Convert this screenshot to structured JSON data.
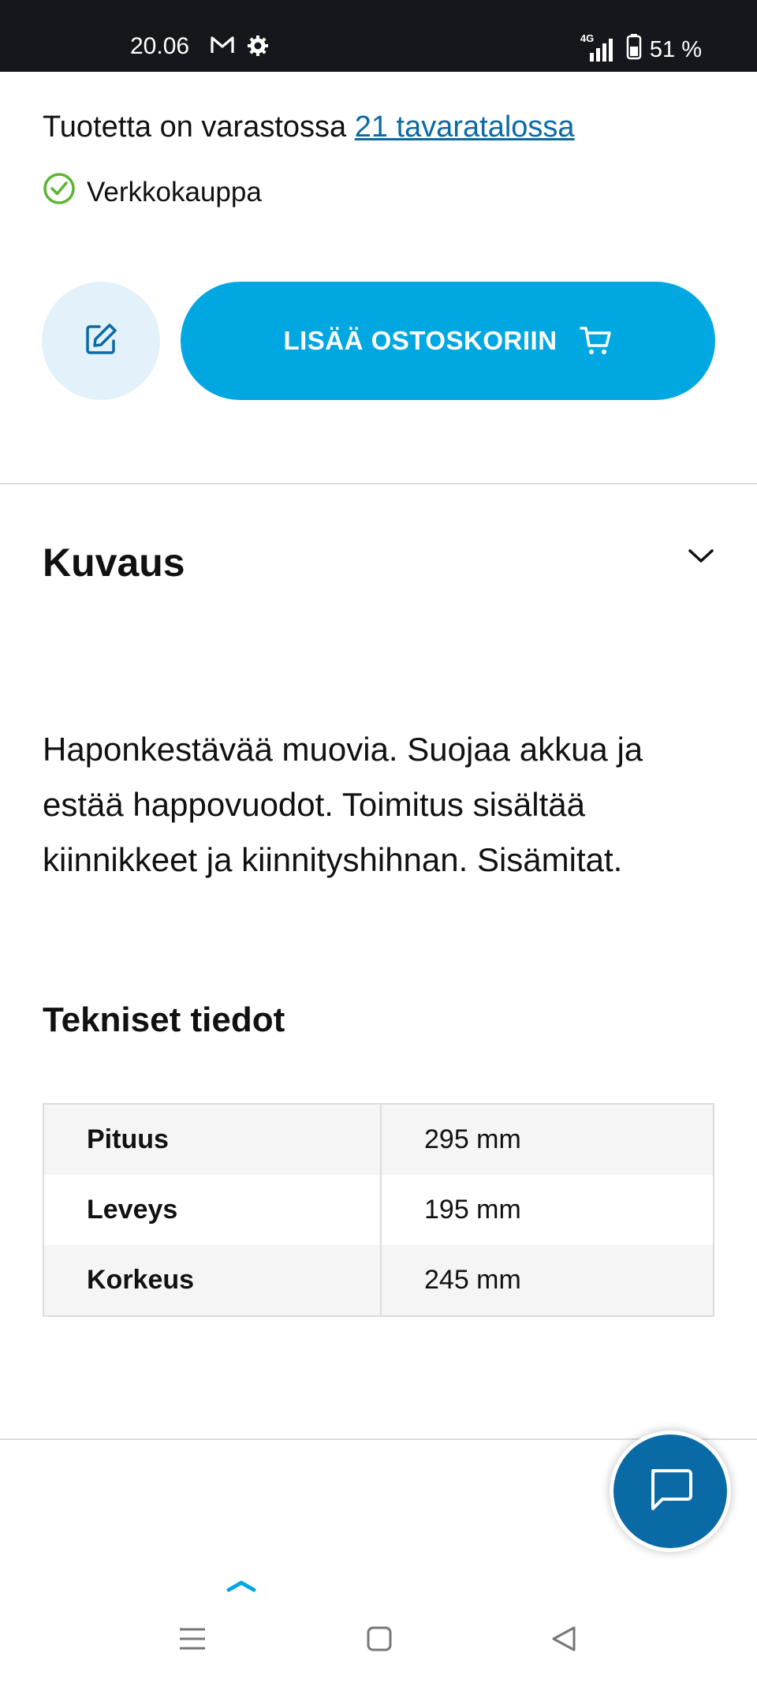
{
  "status_bar": {
    "time": "20.06",
    "network": "4G",
    "battery": "51 %"
  },
  "stock": {
    "prefix": "Tuotetta on varastossa",
    "link": "21 tavaratalossa"
  },
  "webshop": {
    "label": "Verkkokauppa"
  },
  "actions": {
    "add_to_cart": "LISÄÄ OSTOSKORIIN"
  },
  "description": {
    "heading": "Kuvaus",
    "text": "Haponkestävää muovia. Suojaa akkua ja estää happovuodot. Toimitus sisältää kiinnikkeet ja kiinnityshihnan. Sisämitat."
  },
  "specs": {
    "heading": "Tekniset tiedot",
    "rows": [
      {
        "label": "Pituus",
        "value": "295 mm"
      },
      {
        "label": "Leveys",
        "value": "195 mm"
      },
      {
        "label": "Korkeus",
        "value": "245 mm"
      }
    ]
  },
  "colors": {
    "primary": "#00a7e1",
    "link": "#0a6aa6",
    "success": "#5cb531",
    "chat": "#0a6aa6"
  },
  "icons": [
    "mail-icon",
    "settings-icon",
    "signal-icon",
    "battery-icon",
    "check-circle-icon",
    "edit-note-icon",
    "cart-icon",
    "chevron-down-icon",
    "chat-icon",
    "chevron-up-icon",
    "recent-apps-icon",
    "home-icon",
    "back-icon"
  ]
}
